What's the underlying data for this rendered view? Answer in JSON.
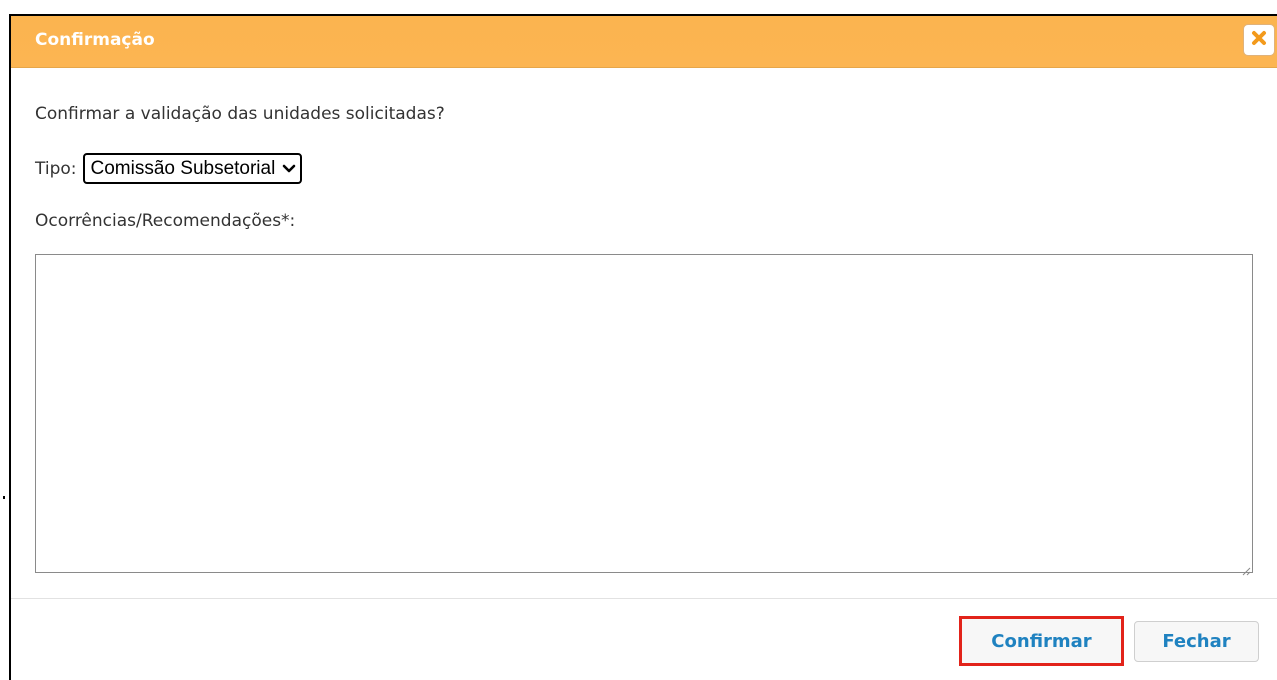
{
  "dialog": {
    "title": "Confirmação",
    "close_icon": "close-x-icon",
    "accent_color": "#fcb552",
    "question": "Confirmar a validação das unidades solicitadas?",
    "tipo": {
      "label": "Tipo:",
      "selected": "Comissão Subsetorial"
    },
    "ocorrencias": {
      "label": "Ocorrências/Recomendações*:",
      "value": ""
    },
    "buttons": {
      "confirm_label": "Confirmar",
      "close_label": "Fechar",
      "highlight_color": "#e2231a"
    }
  }
}
